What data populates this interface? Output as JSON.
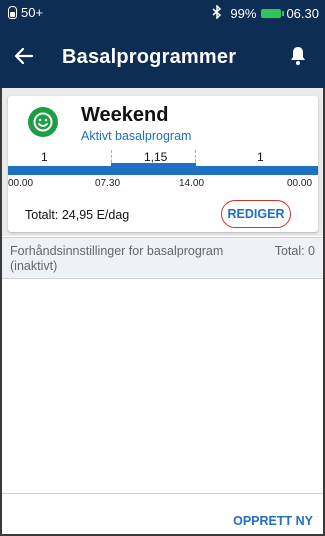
{
  "status_bar": {
    "pod_units": "50+",
    "battery_percent": "99%",
    "time": "06.30",
    "icons": [
      "pod-icon",
      "bluetooth-icon",
      "battery-icon"
    ]
  },
  "header": {
    "title": "Basalprogrammer",
    "back_icon": "back-arrow-icon",
    "notification_icon": "bell-icon"
  },
  "active_program": {
    "icon": "smiley-icon",
    "name": "Weekend",
    "status": "Aktivt basalprogram",
    "total": "Totalt: 24,95 E/dag",
    "edit_label": "REDIGER",
    "segments": [
      {
        "rate": "1",
        "start": "00.00",
        "end": "07.30"
      },
      {
        "rate": "1,15",
        "start": "07.30",
        "end": "14.00"
      },
      {
        "rate": "1",
        "start": "14.00",
        "end": "00.00"
      }
    ],
    "time_labels": [
      "00.00",
      "07.30",
      "14.00",
      "00.00"
    ]
  },
  "presets": {
    "label": "Forhåndsinnstillinger for basalprogram (inaktivt)",
    "total": "Total: 0"
  },
  "footer": {
    "create_new_label": "OPPRETT NY"
  },
  "colors": {
    "header_bg": "#0d2d54",
    "accent_blue": "#1f6fc2",
    "active_green": "#1e9e44",
    "highlight_red": "#d0312d",
    "battery_green": "#2ec65a",
    "segment_divider": "#d8a83a"
  }
}
